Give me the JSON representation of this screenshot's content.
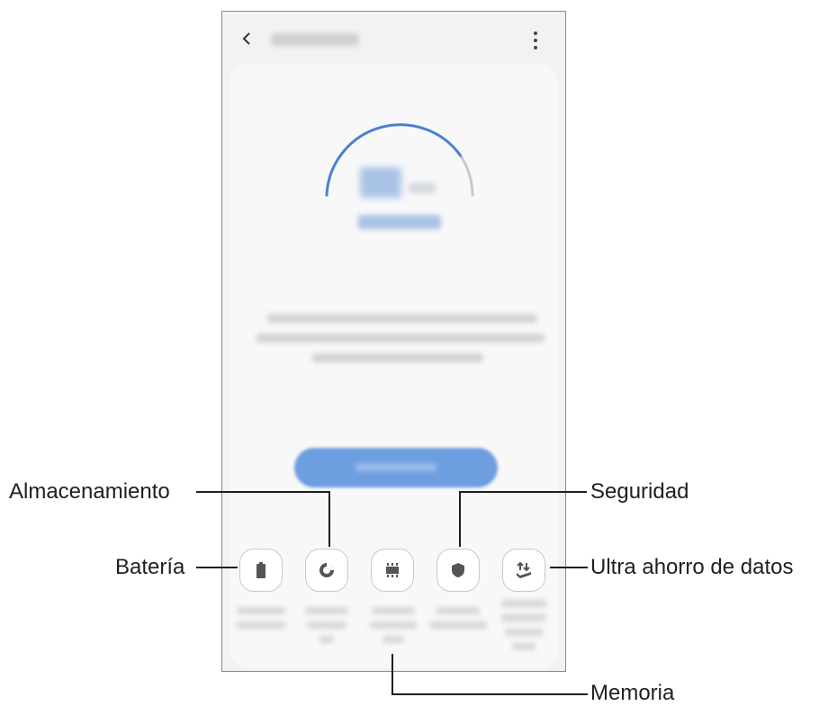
{
  "annotations": {
    "storage": "Almacenamiento",
    "battery": "Batería",
    "security": "Seguridad",
    "data_saver": "Ultra ahorro de datos",
    "memory": "Memoria"
  },
  "toolbar": {
    "back_icon": "chevron-left-icon",
    "more_icon": "more-vert-icon"
  },
  "shortcuts": [
    {
      "icon": "battery-icon"
    },
    {
      "icon": "storage-icon"
    },
    {
      "icon": "memory-icon"
    },
    {
      "icon": "shield-icon"
    },
    {
      "icon": "data-saver-icon"
    }
  ],
  "colors": {
    "accent": "#4a80d0",
    "button": "#6d9ee0",
    "icon": "#555555",
    "callout_line": "#1f1f1f"
  }
}
